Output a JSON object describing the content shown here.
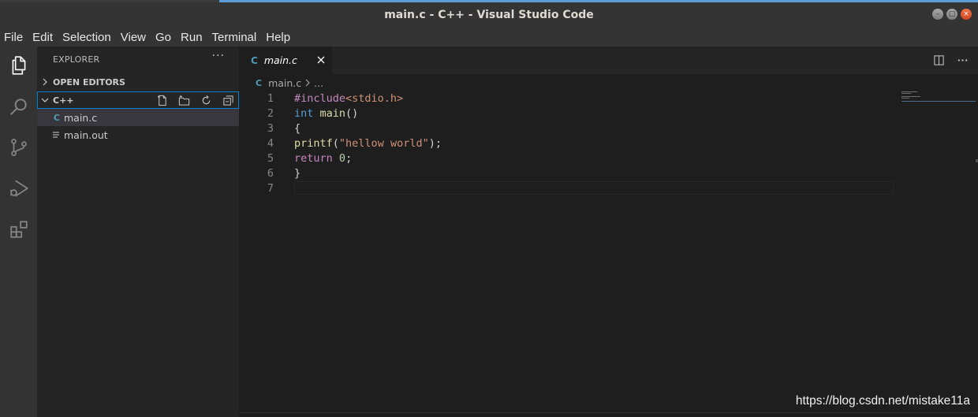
{
  "window": {
    "title": "main.c - C++ - Visual Studio Code",
    "controls": [
      "minimize",
      "maximize",
      "close"
    ]
  },
  "menu": [
    "File",
    "Edit",
    "Selection",
    "View",
    "Go",
    "Run",
    "Terminal",
    "Help"
  ],
  "activity_bar": [
    "explorer-icon",
    "search-icon",
    "source-control-icon",
    "run-debug-icon",
    "extensions-icon"
  ],
  "sidebar": {
    "header": "EXPLORER",
    "more": "···",
    "open_editors": "OPEN EDITORS",
    "folder": "C++",
    "folder_actions": [
      "new-file-icon",
      "new-folder-icon",
      "refresh-icon",
      "collapse-all-icon"
    ],
    "files": [
      {
        "icon": "C",
        "name": "main.c",
        "selected": true
      },
      {
        "icon": "lines-icon",
        "name": "main.out",
        "selected": false
      }
    ]
  },
  "tabs": [
    {
      "icon": "C",
      "label": "main.c",
      "active": true
    }
  ],
  "breadcrumb": {
    "icon": "C",
    "file": "main.c",
    "rest": "..."
  },
  "editor": {
    "lines": [
      {
        "n": "1",
        "tokens": [
          {
            "t": "#include",
            "c": "tok-pre"
          },
          {
            "t": "<stdio.h>",
            "c": "tok-inc"
          }
        ]
      },
      {
        "n": "2",
        "tokens": [
          {
            "t": "int",
            "c": "tok-kw"
          },
          {
            "t": " "
          },
          {
            "t": "main",
            "c": "tok-fn"
          },
          {
            "t": "()"
          }
        ]
      },
      {
        "n": "3",
        "tokens": [
          {
            "t": "{"
          }
        ]
      },
      {
        "n": "4",
        "tokens": [
          {
            "t": "printf",
            "c": "tok-fn"
          },
          {
            "t": "("
          },
          {
            "t": "\"hellow world\"",
            "c": "tok-str"
          },
          {
            "t": ");"
          }
        ]
      },
      {
        "n": "5",
        "tokens": [
          {
            "t": "return",
            "c": "tok-ret"
          },
          {
            "t": " "
          },
          {
            "t": "0",
            "c": "tok-num"
          },
          {
            "t": ";"
          }
        ]
      },
      {
        "n": "6",
        "tokens": [
          {
            "t": "}"
          }
        ]
      },
      {
        "n": "7",
        "tokens": []
      }
    ]
  },
  "watermark": "https://blog.csdn.net/mistake11a",
  "colors": {
    "accent": "#007fd4",
    "c_icon": "#519aba",
    "titlebar": "#343434",
    "close_button": "#e3572b"
  }
}
